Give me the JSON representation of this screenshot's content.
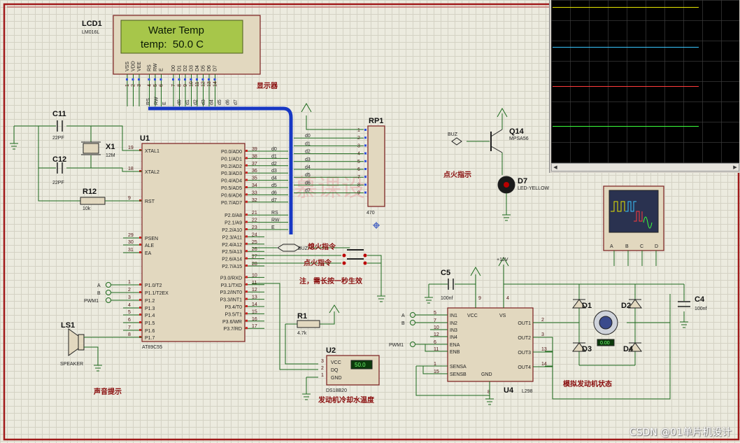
{
  "lcd": {
    "ref": "LCD1",
    "model": "LM016L",
    "line1": "Water Temp",
    "line2": "temp:  50.0 C",
    "pins": [
      "VSS",
      "VDD",
      "VEE",
      "RS",
      "RW",
      "E",
      "D0",
      "D1",
      "D2",
      "D3",
      "D4",
      "D5",
      "D6",
      "D7"
    ],
    "pin_numbers": [
      "1",
      "2",
      "3",
      "4",
      "5",
      "6",
      "7",
      "8",
      "9",
      "10",
      "11",
      "12",
      "13",
      "14"
    ],
    "caption": "显示器"
  },
  "mcu": {
    "ref": "U1",
    "model": "AT89C55",
    "left_pins": [
      {
        "num": "19",
        "name": "XTAL1"
      },
      {
        "num": "18",
        "name": "XTAL2"
      },
      {
        "num": "9",
        "name": "RST"
      },
      {
        "num": "29",
        "name": "PSEN"
      },
      {
        "num": "30",
        "name": "ALE"
      },
      {
        "num": "31",
        "name": "EA"
      },
      {
        "num": "1",
        "name": "P1.0/T2"
      },
      {
        "num": "2",
        "name": "P1.1/T2EX"
      },
      {
        "num": "3",
        "name": "P1.2"
      },
      {
        "num": "4",
        "name": "P1.3"
      },
      {
        "num": "5",
        "name": "P1.4"
      },
      {
        "num": "6",
        "name": "P1.5"
      },
      {
        "num": "7",
        "name": "P1.6"
      },
      {
        "num": "8",
        "name": "P1.7"
      }
    ],
    "right_pins": [
      {
        "num": "39",
        "name": "P0.0/AD0",
        "net": "d0"
      },
      {
        "num": "38",
        "name": "P0.1/AD1",
        "net": "d1"
      },
      {
        "num": "37",
        "name": "P0.2/AD2",
        "net": "d2"
      },
      {
        "num": "36",
        "name": "P0.3/AD3",
        "net": "d3"
      },
      {
        "num": "35",
        "name": "P0.4/AD4",
        "net": "d4"
      },
      {
        "num": "34",
        "name": "P0.5/AD5",
        "net": "d5"
      },
      {
        "num": "33",
        "name": "P0.6/AD6",
        "net": "d6"
      },
      {
        "num": "32",
        "name": "P0.7/AD7",
        "net": "d7"
      },
      {
        "num": "21",
        "name": "P2.0/A8",
        "net": "RS"
      },
      {
        "num": "22",
        "name": "P2.1/A9",
        "net": "RW"
      },
      {
        "num": "23",
        "name": "P2.2/A10",
        "net": "E"
      },
      {
        "num": "24",
        "name": "P2.3/A11",
        "net": ""
      },
      {
        "num": "25",
        "name": "P2.4/A12",
        "net": ""
      },
      {
        "num": "26",
        "name": "P2.5/A13",
        "net": ""
      },
      {
        "num": "27",
        "name": "P2.6/A14",
        "net": ""
      },
      {
        "num": "28",
        "name": "P2.7/A15",
        "net": ""
      },
      {
        "num": "10",
        "name": "P3.0/RXD",
        "net": ""
      },
      {
        "num": "11",
        "name": "P3.1/TXD",
        "net": ""
      },
      {
        "num": "12",
        "name": "P3.2/INT0",
        "net": ""
      },
      {
        "num": "13",
        "name": "P3.3/INT1",
        "net": ""
      },
      {
        "num": "14",
        "name": "P3.4/T0",
        "net": ""
      },
      {
        "num": "15",
        "name": "P3.5/T1",
        "net": ""
      },
      {
        "num": "16",
        "name": "P3.6/WR",
        "net": ""
      },
      {
        "num": "17",
        "name": "P3.7/RD",
        "net": ""
      }
    ],
    "terminals_left": [
      "A",
      "B",
      "PWM1"
    ]
  },
  "crystal": {
    "ref": "X1",
    "value": "12M"
  },
  "c11": {
    "ref": "C11",
    "value": "22PF"
  },
  "c12": {
    "ref": "C12",
    "value": "22PF"
  },
  "r12": {
    "ref": "R12",
    "value": "10k"
  },
  "rp1": {
    "ref": "RP1",
    "value": "470",
    "pins": [
      "1",
      "2",
      "3",
      "4",
      "5",
      "6",
      "7",
      "8",
      "9"
    ],
    "nets": [
      "d0",
      "d1",
      "d2",
      "d3",
      "d4",
      "d5",
      "d6",
      "d7"
    ]
  },
  "lcd_bus_labels": [
    "RS",
    "RW",
    "E",
    "d0",
    "d1",
    "d2",
    "d3",
    "d4",
    "d5",
    "d6",
    "d7"
  ],
  "q14": {
    "ref": "Q14",
    "model": "MPSA56",
    "net": "BUZ",
    "caption": "点火指示"
  },
  "d7": {
    "ref": "D7",
    "model": "LED-YELLOW"
  },
  "speaker": {
    "ref": "LS1",
    "model": "SPEAKER",
    "caption": "声音提示"
  },
  "buttons": {
    "buz_net": "BUZ",
    "btn1": "熄火指令",
    "btn2": "点火指令",
    "note": "注，需长按一秒生效"
  },
  "r1": {
    "ref": "R1",
    "value": "4.7k"
  },
  "u2": {
    "ref": "U2",
    "model": "DS18B20",
    "pins": [
      "VCC",
      "DQ",
      "GND"
    ],
    "pin_numbers": [
      "3",
      "2",
      "1"
    ],
    "reading": "50.0",
    "caption": "发动机冷却水温度"
  },
  "c5": {
    "ref": "C5",
    "value": "100nf"
  },
  "c4": {
    "ref": "C4",
    "value": "100nf"
  },
  "u4": {
    "ref": "U4",
    "model": "L298",
    "left_pins": [
      {
        "num": "5",
        "name": "IN1"
      },
      {
        "num": "7",
        "name": "IN2"
      },
      {
        "num": "10",
        "name": "IN3"
      },
      {
        "num": "12",
        "name": "IN4"
      },
      {
        "num": "6",
        "name": "ENA"
      },
      {
        "num": "11",
        "name": "ENB"
      },
      {
        "num": "1",
        "name": "SENSA"
      },
      {
        "num": "15",
        "name": "SENSB"
      }
    ],
    "right_pins": [
      {
        "num": "2",
        "name": "OUT1"
      },
      {
        "num": "3",
        "name": "OUT2"
      },
      {
        "num": "13",
        "name": "OUT3"
      },
      {
        "num": "14",
        "name": "OUT4"
      }
    ],
    "top_pins": [
      {
        "num": "9",
        "name": "VCC"
      },
      {
        "num": "4",
        "name": "VS"
      }
    ],
    "bottom_pin": {
      "num": "8",
      "name": "GND"
    },
    "terminals": [
      "A",
      "B",
      "PWM1"
    ]
  },
  "supply": "+12V",
  "diodes": [
    "D1",
    "D2",
    "D3",
    "D4"
  ],
  "motor": {
    "reading": "0.00",
    "caption": "模拟发动机状态"
  },
  "oscope": {
    "channels": [
      "A",
      "B",
      "C",
      "D"
    ]
  },
  "scope_traces": [
    {
      "color": "#e6e600"
    },
    {
      "color": "#39c6ff"
    },
    {
      "color": "#ff3b3b"
    },
    {
      "color": "#3cff3c"
    }
  ],
  "watermark_text": "慕课设",
  "credit": "CSDN @01单片机设计"
}
